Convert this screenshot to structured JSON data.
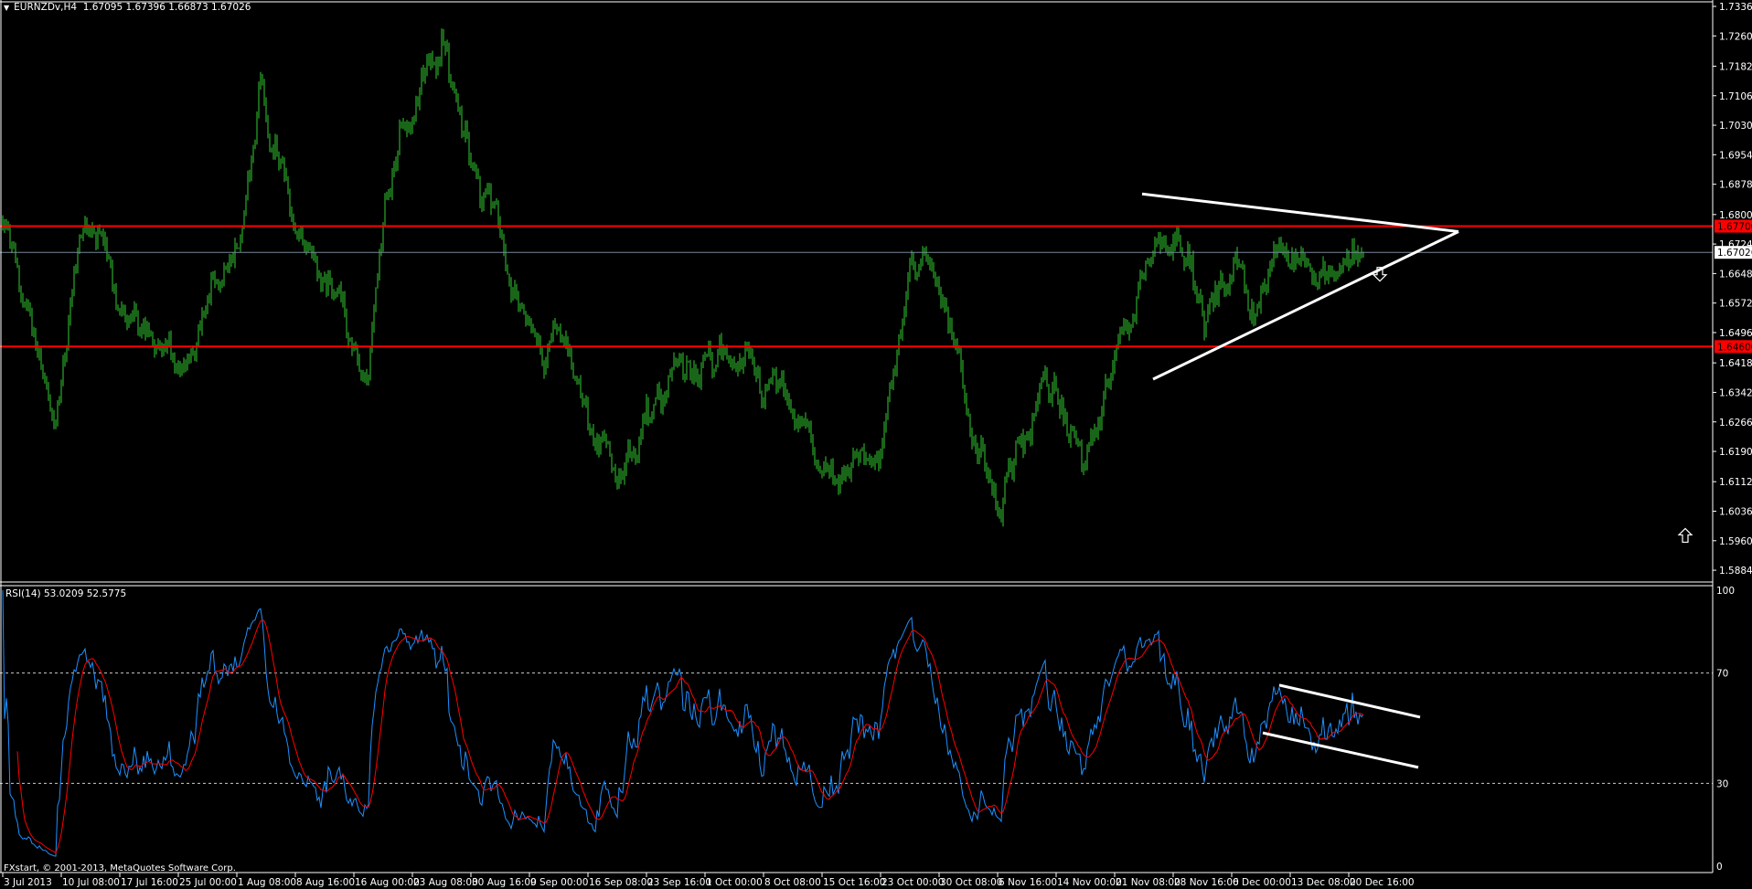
{
  "header": {
    "menu_icon": "triangle-down-icon",
    "symbol": "EURNZDv,H4",
    "ohlc": "1.67095 1.67396 1.66873 1.67026"
  },
  "rsi_header": "RSI(14) 53.0209 52.5775",
  "copyright": "FXstart, © 2001-2013, MetaQuotes Software Corp.",
  "colors": {
    "background": "#000000",
    "bars": "#32cd32",
    "rsi": "#1e90ff",
    "rsi_ma": "#ff0000",
    "level_line": "#ff0000",
    "current_line": "#778899",
    "trendline": "#ffffff"
  },
  "chart_data": [
    {
      "type": "ohlc-bar",
      "symbol": "EURNZDv",
      "timeframe": "H4",
      "price_ticks": [
        "1.73360",
        "1.72600",
        "1.71820",
        "1.71060",
        "1.70300",
        "1.69540",
        "1.68780",
        "1.68000",
        "1.67240",
        "1.66480",
        "1.65720",
        "1.64960",
        "1.64180",
        "1.63420",
        "1.62660",
        "1.61900",
        "1.61120",
        "1.60360",
        "1.59600",
        "1.58840"
      ],
      "ylim": [
        1.5884,
        1.7336
      ],
      "time_ticks": [
        "3 Jul 2013",
        "10 Jul 08:00",
        "17 Jul 16:00",
        "25 Jul 00:00",
        "1 Aug 08:00",
        "8 Aug 16:00",
        "16 Aug 00:00",
        "23 Aug 08:00",
        "30 Aug 16:00",
        "9 Sep 00:00",
        "16 Sep 08:00",
        "23 Sep 16:00",
        "1 Oct 00:00",
        "8 Oct 08:00",
        "15 Oct 16:00",
        "23 Oct 00:00",
        "30 Oct 08:00",
        "6 Nov 16:00",
        "14 Nov 00:00",
        "21 Nov 08:00",
        "28 Nov 16:00",
        "6 Dec 00:00",
        "13 Dec 08:00",
        "20 Dec 16:00"
      ],
      "bar_count": 746,
      "bars_per_time_tick": 32,
      "price_path_bar_price": [
        [
          3,
          1.6745
        ],
        [
          30,
          1.6276
        ],
        [
          46,
          1.6772
        ],
        [
          76,
          1.6503
        ],
        [
          104,
          1.6417
        ],
        [
          131,
          1.6786
        ],
        [
          142,
          1.7125
        ],
        [
          159,
          1.6772
        ],
        [
          183,
          1.6589
        ],
        [
          201,
          1.6376
        ],
        [
          210,
          1.6872
        ],
        [
          223,
          1.7069
        ],
        [
          241,
          1.7225
        ],
        [
          253,
          1.7041
        ],
        [
          271,
          1.68
        ],
        [
          287,
          1.6503
        ],
        [
          305,
          1.6448
        ],
        [
          339,
          1.6134
        ],
        [
          366,
          1.639
        ],
        [
          393,
          1.6417
        ],
        [
          427,
          1.6334
        ],
        [
          458,
          1.6065
        ],
        [
          482,
          1.622
        ],
        [
          497,
          1.6645
        ],
        [
          512,
          1.6673
        ],
        [
          528,
          1.6334
        ],
        [
          546,
          1.6079
        ],
        [
          570,
          1.6362
        ],
        [
          592,
          1.6134
        ],
        [
          610,
          1.6448
        ],
        [
          622,
          1.6617
        ],
        [
          644,
          1.6814
        ],
        [
          659,
          1.6503
        ],
        [
          674,
          1.6659
        ],
        [
          683,
          1.6531
        ],
        [
          698,
          1.6714
        ],
        [
          723,
          1.6673
        ],
        [
          745,
          1.67026
        ]
      ],
      "horizontal_levels": [
        {
          "price": 1.677,
          "label": "1.67700",
          "color": "#ff0000"
        },
        {
          "price": 1.646,
          "label": "1.64600",
          "color": "#ff0000"
        }
      ],
      "current_price": {
        "price": 1.67026,
        "label": "1.67026"
      },
      "trendlines": [
        {
          "from": [
            624,
            1.6853
          ],
          "to": [
            797,
            1.6756
          ]
        },
        {
          "from": [
            630,
            1.6376
          ],
          "to": [
            797,
            1.6756
          ]
        }
      ],
      "arrows": [
        {
          "type": "down",
          "bar": 754,
          "price": 1.6645
        },
        {
          "type": "up",
          "bar": 921,
          "price": 1.5975
        }
      ]
    },
    {
      "type": "line",
      "title": "RSI(14) 53.0209 52.5775",
      "series": [
        {
          "name": "RSI(14)",
          "last": 53.0209
        },
        {
          "name": "MA of RSI",
          "last": 52.5775
        }
      ],
      "ylim": [
        0,
        100
      ],
      "y_ticks": [
        "100",
        "70",
        "30",
        "0"
      ],
      "levels": [
        70,
        30
      ],
      "trendlines": [
        {
          "from": [
            699,
            65.6
          ],
          "to": [
            776,
            54.0
          ]
        },
        {
          "from": [
            690,
            48.3
          ],
          "to": [
            775,
            35.8
          ]
        }
      ]
    }
  ]
}
